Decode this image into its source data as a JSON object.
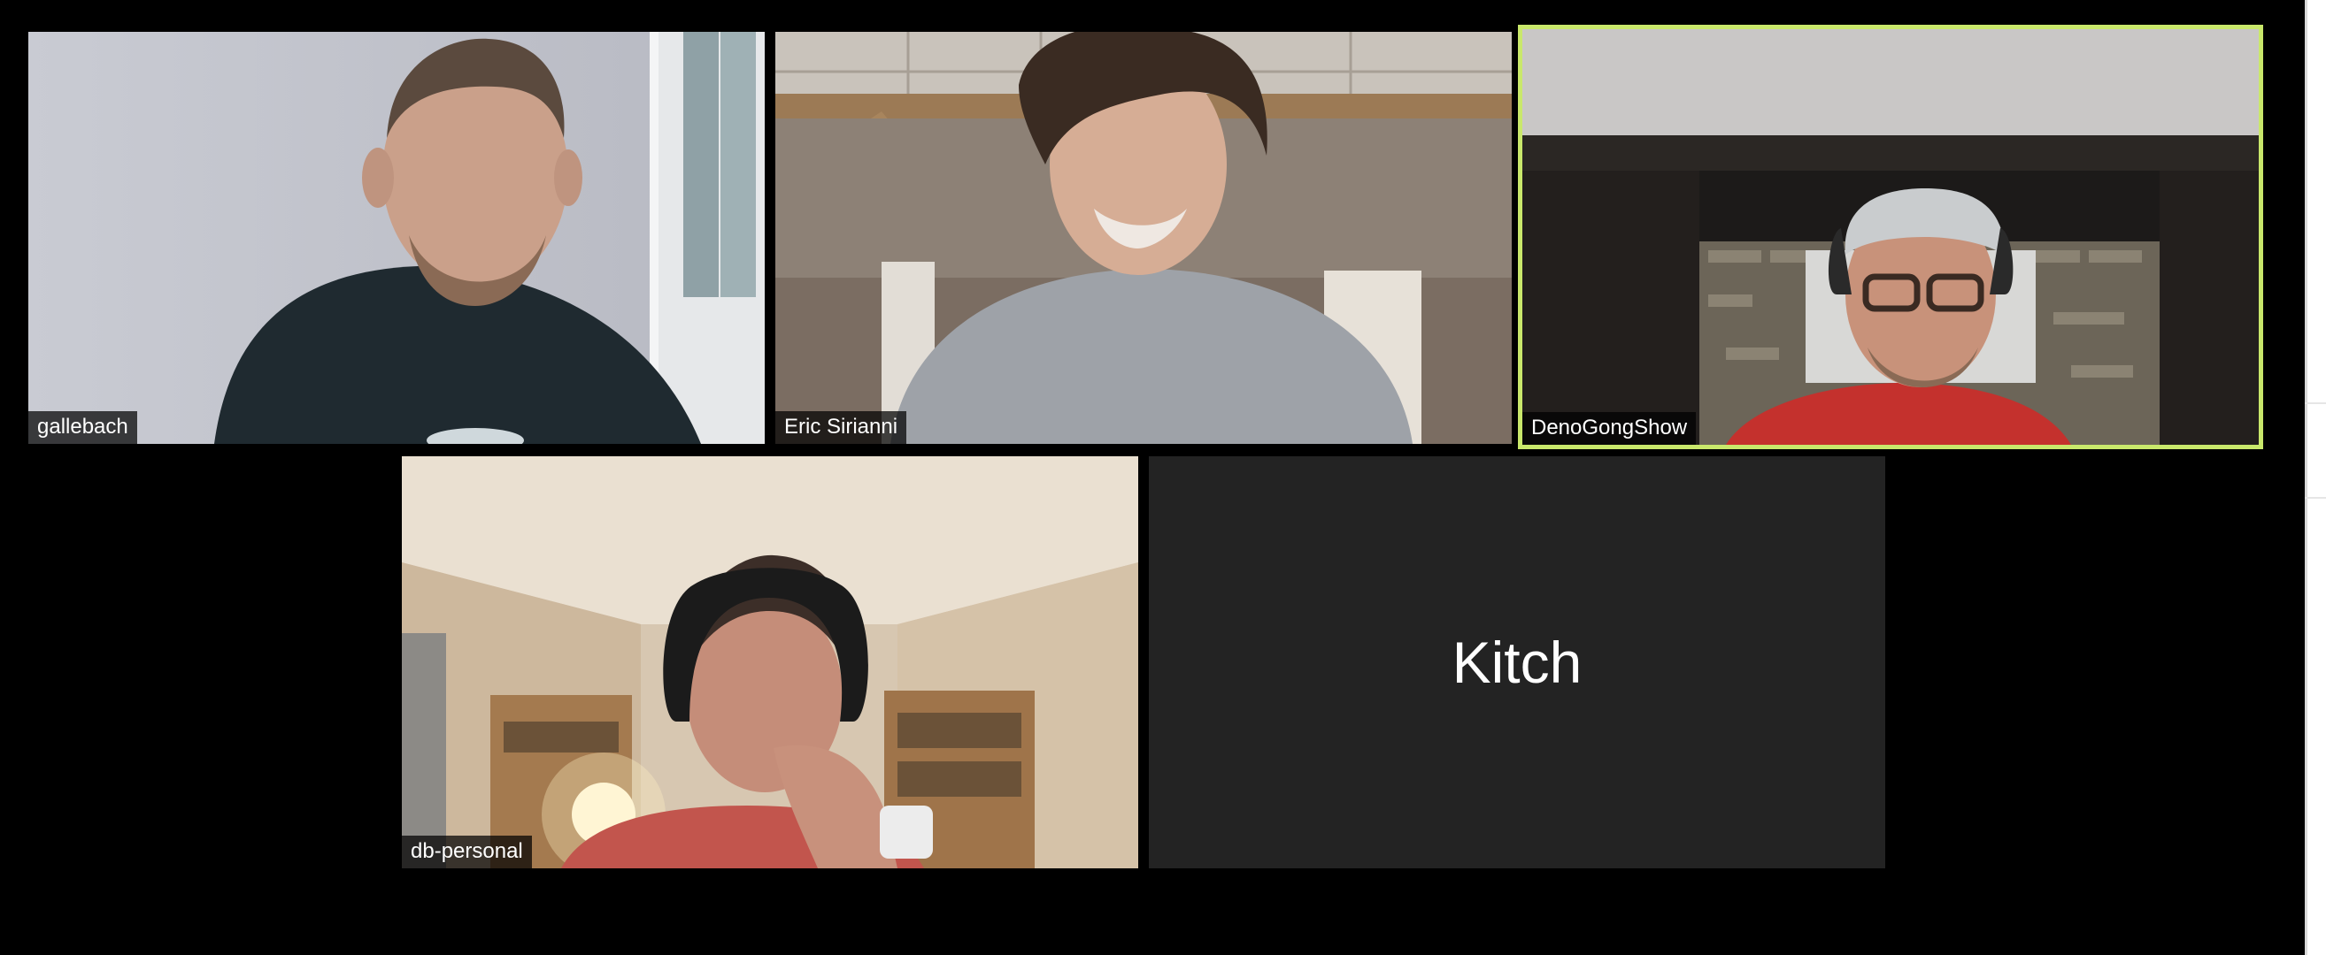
{
  "participants": [
    {
      "name": "gallebach",
      "video": true,
      "active": false
    },
    {
      "name": "Eric Sirianni",
      "video": true,
      "active": false
    },
    {
      "name": "DenoGongShow",
      "video": true,
      "active": true
    },
    {
      "name": "db-personal",
      "video": true,
      "active": false
    },
    {
      "name": "Kitch",
      "video": false,
      "active": false
    }
  ],
  "colors": {
    "background": "#000000",
    "tile_placeholder": "#222222",
    "active_speaker_border": "#c9e86b",
    "name_tag_text": "#ffffff"
  }
}
